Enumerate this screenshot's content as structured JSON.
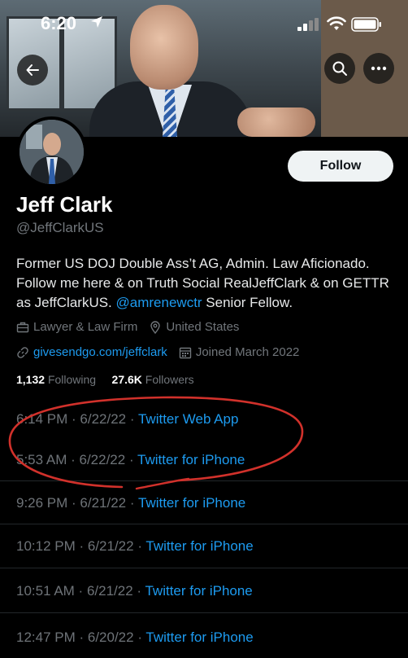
{
  "status_bar": {
    "time": "6:20"
  },
  "profile": {
    "follow_label": "Follow",
    "name": "Jeff Clark",
    "handle": "@JeffClarkUS",
    "bio_part1": "Former US DOJ Double Ass’t AG, Admin. Law Aficionado. Follow me here & on Truth Social RealJeffClark & on GETTR as JeffClarkUS. ",
    "bio_mention": "@amrenewctr",
    "bio_part2": " Senior Fellow.",
    "category": "Lawyer & Law Firm",
    "location": "United States",
    "website": "givesendgo.com/jeffclark",
    "joined": "Joined March 2022",
    "following_count": "1,132",
    "following_label": "Following",
    "followers_count": "27.6K",
    "followers_label": "Followers"
  },
  "tweets": [
    {
      "time": "6:14 PM",
      "date": "6/22/22",
      "source": "Twitter Web App"
    },
    {
      "time": "5:53 AM",
      "date": "6/22/22",
      "source": "Twitter for iPhone"
    },
    {
      "time": "9:26 PM",
      "date": "6/21/22",
      "source": "Twitter for iPhone"
    },
    {
      "time": "10:12 PM",
      "date": "6/21/22",
      "source": "Twitter for iPhone"
    },
    {
      "time": "10:51 AM",
      "date": "6/21/22",
      "source": "Twitter for iPhone"
    },
    {
      "time": "12:47 PM",
      "date": "6/20/22",
      "source": "Twitter for iPhone"
    }
  ],
  "colors": {
    "link": "#1d9bf0",
    "annotation": "#d1312b"
  },
  "icons": [
    "location-arrow-icon",
    "signal-icon",
    "wifi-icon",
    "battery-icon",
    "back-arrow-icon",
    "search-icon",
    "more-icon",
    "briefcase-icon",
    "location-pin-icon",
    "link-icon",
    "calendar-icon"
  ]
}
